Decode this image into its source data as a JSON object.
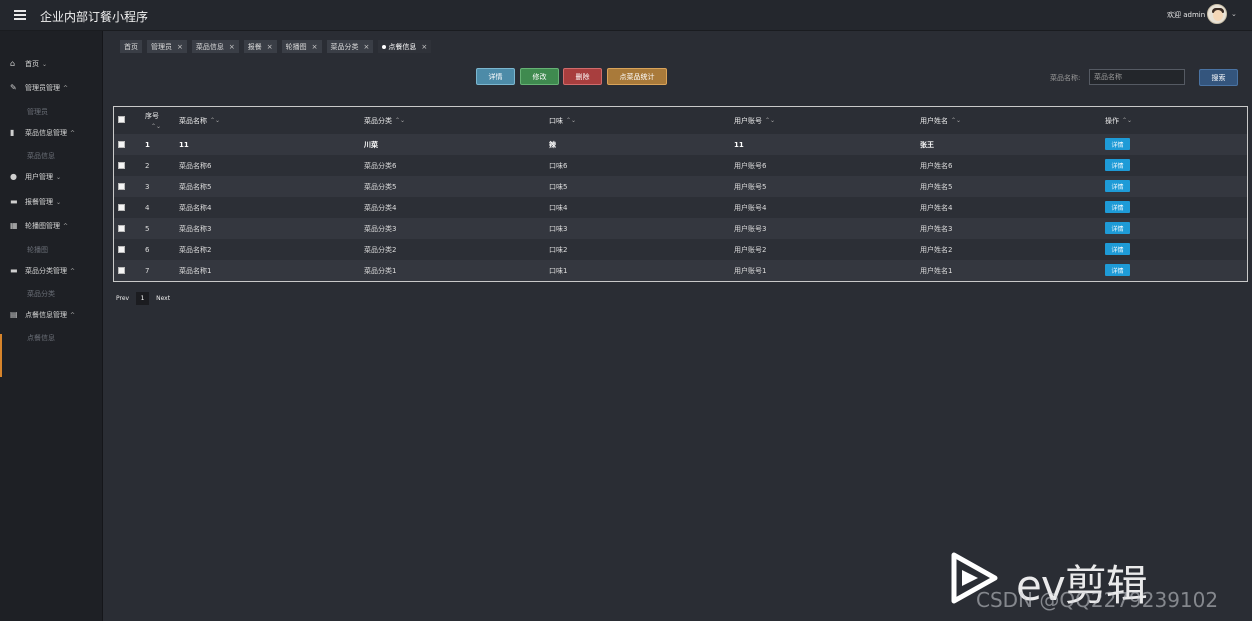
{
  "header": {
    "app_title": "企业内部订餐小程序",
    "welcome": "欢迎 admin",
    "caret": "⌄"
  },
  "sidebar": {
    "items": [
      {
        "label": "首页",
        "icon": "home-icon",
        "arrow": "⌄"
      },
      {
        "label": "管理员管理",
        "icon": "edit-icon",
        "arrow": "^",
        "sub": "管理员"
      },
      {
        "label": "菜品信息管理",
        "icon": "book-icon",
        "arrow": "^",
        "sub": "菜品信息"
      },
      {
        "label": "用户管理",
        "icon": "user-icon",
        "arrow": "⌄"
      },
      {
        "label": "报餐管理",
        "icon": "car-icon",
        "arrow": "⌄"
      },
      {
        "label": "轮播图管理",
        "icon": "table-icon",
        "arrow": "^",
        "sub": "轮播图"
      },
      {
        "label": "菜品分类管理",
        "icon": "stack-icon",
        "arrow": "^",
        "sub": "菜品分类"
      },
      {
        "label": "点餐信息管理",
        "icon": "receipt-icon",
        "arrow": "^",
        "sub": "点餐信息"
      }
    ]
  },
  "tabs": [
    {
      "label": "首页",
      "closable": false
    },
    {
      "label": "管理员",
      "closable": true
    },
    {
      "label": "菜品信息",
      "closable": true
    },
    {
      "label": "报餐",
      "closable": true
    },
    {
      "label": "轮播图",
      "closable": true
    },
    {
      "label": "菜品分类",
      "closable": true
    },
    {
      "label": "点餐信息",
      "closable": true,
      "active": true
    }
  ],
  "tab_close": "×",
  "actions": {
    "detail": "详情",
    "edit": "修改",
    "delete": "删除",
    "stats": "点菜品统计"
  },
  "search": {
    "label": "菜品名称:",
    "placeholder": "菜品名称",
    "button": "搜索"
  },
  "table": {
    "headers": [
      "序号",
      "菜品名称",
      "菜品分类",
      "口味",
      "用户账号",
      "用户姓名",
      "操作"
    ],
    "sort_glyph": "⌃⌄",
    "op_label": "详情",
    "rows": [
      [
        "1",
        "11",
        "川菜",
        "辣",
        "11",
        "张王"
      ],
      [
        "2",
        "菜品名称6",
        "菜品分类6",
        "口味6",
        "用户账号6",
        "用户姓名6"
      ],
      [
        "3",
        "菜品名称5",
        "菜品分类5",
        "口味5",
        "用户账号5",
        "用户姓名5"
      ],
      [
        "4",
        "菜品名称4",
        "菜品分类4",
        "口味4",
        "用户账号4",
        "用户姓名4"
      ],
      [
        "5",
        "菜品名称3",
        "菜品分类3",
        "口味3",
        "用户账号3",
        "用户姓名3"
      ],
      [
        "6",
        "菜品名称2",
        "菜品分类2",
        "口味2",
        "用户账号2",
        "用户姓名2"
      ],
      [
        "7",
        "菜品名称1",
        "菜品分类1",
        "口味1",
        "用户账号1",
        "用户姓名1"
      ]
    ]
  },
  "pagination": {
    "prev": "Prev",
    "current": "1",
    "next": "Next"
  },
  "watermark": {
    "brand": "ev剪辑",
    "csdn": "CSDN @QQ2279239102"
  }
}
